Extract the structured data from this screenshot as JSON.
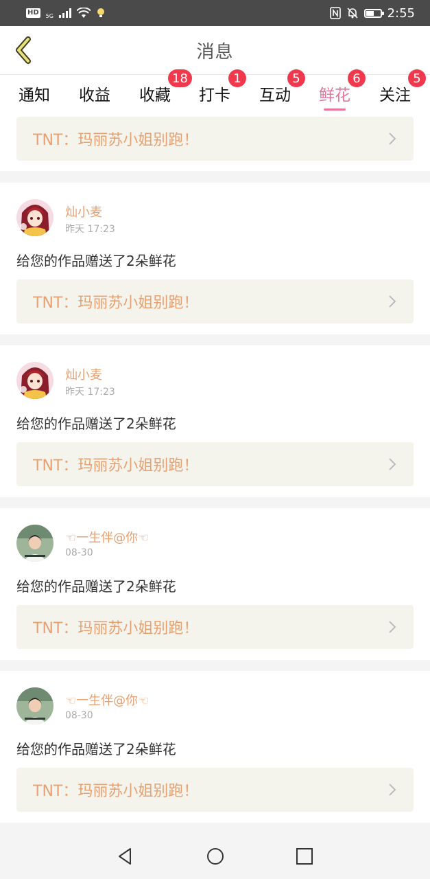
{
  "status_bar": {
    "hd": "HD",
    "network": "5G",
    "time": "2:55",
    "battery_level": 0.55,
    "icons": [
      "signal-icon",
      "wifi-icon",
      "bulb-icon",
      "nfc-icon",
      "mute-bell-icon",
      "battery-icon"
    ]
  },
  "header": {
    "title": "消息",
    "back_icon": "chevron-left-icon",
    "accent_color": "#e8e07a"
  },
  "tabs": [
    {
      "label": "通知",
      "badge": ""
    },
    {
      "label": "收益",
      "badge": ""
    },
    {
      "label": "收藏",
      "badge": "18"
    },
    {
      "label": "打卡",
      "badge": "1"
    },
    {
      "label": "互动",
      "badge": "5"
    },
    {
      "label": "鲜花",
      "badge": "6",
      "active": true
    },
    {
      "label": "关注",
      "badge": "5"
    }
  ],
  "colors": {
    "active_tab": "#e8729a",
    "badge": "#f0394d",
    "username": "#e8a070",
    "work_title": "#e8a070",
    "work_bg": "#f5f4ec"
  },
  "feed": {
    "partial_top": {
      "work_title": "TNT：玛丽苏小姐别跑！"
    },
    "items": [
      {
        "user": "灿小麦",
        "time": "昨天 17:23",
        "message": "给您的作品赠送了2朵鲜花",
        "work_title": "TNT：玛丽苏小姐别跑！"
      },
      {
        "user": "灿小麦",
        "time": "昨天 17:23",
        "message": "给您的作品赠送了2朵鲜花",
        "work_title": "TNT：玛丽苏小姐别跑！"
      },
      {
        "user": "☜一生伴@你☜",
        "time": "08-30",
        "message": "给您的作品赠送了2朵鲜花",
        "work_title": "TNT：玛丽苏小姐别跑！"
      },
      {
        "user": "☜一生伴@你☜",
        "time": "08-30",
        "message": "给您的作品赠送了2朵鲜花",
        "work_title": "TNT：玛丽苏小姐别跑！"
      }
    ]
  },
  "nav_bar": {
    "icons": [
      "back-triangle-icon",
      "home-circle-icon",
      "recents-square-icon"
    ]
  }
}
